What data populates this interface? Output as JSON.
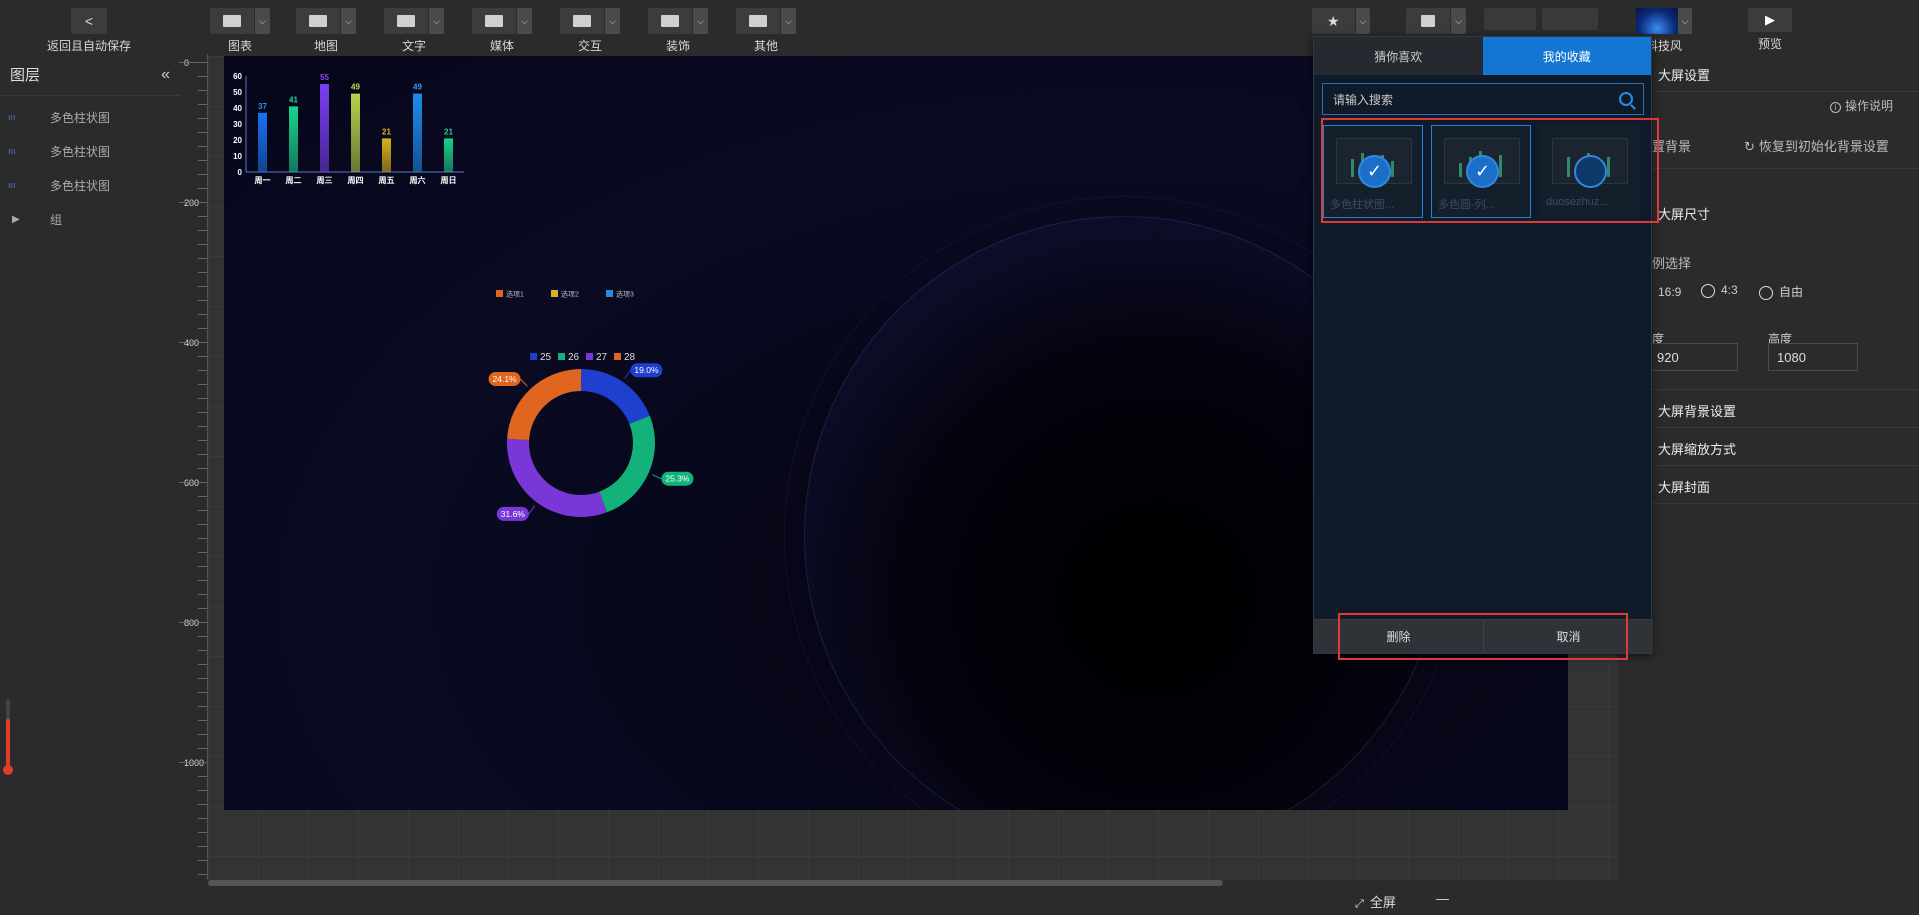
{
  "toolbar": {
    "back_label": "返回且自动保存",
    "items": [
      {
        "label": "图表",
        "icon": "chart-icon"
      },
      {
        "label": "地图",
        "icon": "map-icon"
      },
      {
        "label": "文字",
        "icon": "text-icon"
      },
      {
        "label": "媒体",
        "icon": "media-icon"
      },
      {
        "label": "交互",
        "icon": "interaction-icon"
      },
      {
        "label": "装饰",
        "icon": "decoration-icon"
      },
      {
        "label": "其他",
        "icon": "other-icon"
      }
    ],
    "theme_label": "科技风",
    "preview_label": "预览"
  },
  "layers": {
    "title": "图层",
    "items": [
      {
        "label": "多色柱状图",
        "icon_text": "ııı"
      },
      {
        "label": "多色柱状图",
        "icon_text": "ııı"
      },
      {
        "label": "多色柱状图",
        "icon_text": "ııı"
      }
    ],
    "group_label": "组"
  },
  "ruler": {
    "labels": [
      "0",
      "200",
      "400",
      "600",
      "800",
      "1000"
    ]
  },
  "chart_data": [
    {
      "type": "bar",
      "categories": [
        "周一",
        "周二",
        "周三",
        "周四",
        "周五",
        "周六",
        "周日"
      ],
      "values": [
        37,
        41,
        55,
        49,
        21,
        49,
        21
      ],
      "ylim": [
        0,
        60
      ],
      "yticks": [
        "0",
        "10",
        "20",
        "30",
        "40",
        "50",
        "60"
      ],
      "colors": [
        "#1a72f0",
        "#19d48e",
        "#7b3ff2",
        "#b8d24a",
        "#d8b41a",
        "#1f8cf0",
        "#1ed08a"
      ],
      "label_colors": [
        "#2f8ff0",
        "#21d49a",
        "#8a4cf2",
        "#c8dc4f",
        "#e3b824",
        "#2f9cf0",
        "#21d49a"
      ]
    },
    {
      "type": "bar",
      "categories": [],
      "values": [],
      "legend": [
        "选项1",
        "选项2",
        "选项3"
      ],
      "legend_colors": [
        "#e0661f",
        "#d9b51d",
        "#2f88e0"
      ]
    },
    {
      "type": "pie",
      "categories": [
        "25",
        "26",
        "27",
        "28"
      ],
      "values": [
        19.0,
        25.3,
        31.6,
        24.1
      ],
      "labels": [
        "19.0%",
        "25.3%",
        "31.6%",
        "24.1%"
      ],
      "colors": [
        "#1f3fcf",
        "#12b27a",
        "#7a37d8",
        "#e0661f"
      ]
    }
  ],
  "popup": {
    "tabs": [
      "猜你喜欢",
      "我的收藏"
    ],
    "active_tab": "我的收藏",
    "search_placeholder": "请输入搜索",
    "favorites": [
      {
        "name": "多色柱状图...",
        "checked": true
      },
      {
        "name": "多色圆-列...",
        "checked": true
      },
      {
        "name": "duosezhuz...",
        "checked": false
      }
    ],
    "delete_label": "删除",
    "cancel_label": "取消"
  },
  "settings": {
    "title": "大屏设置",
    "help_label": "操作说明",
    "bg_label": "置背景",
    "reset_bg_label": "恢复到初始化背景设置",
    "size_section": "大屏尺寸",
    "ratio_label": "例选择",
    "ratios": [
      "16:9",
      "4:3",
      "自由"
    ],
    "width_label": "度",
    "height_label": "高度",
    "width_value": "920",
    "height_value": "1080",
    "sections": [
      "大屏背景设置",
      "大屏缩放方式",
      "大屏封面"
    ]
  },
  "statusbar": {
    "fullscreen_label": "全屏",
    "zoom_minus": "—"
  },
  "colors": {
    "accent": "#1476d3",
    "highlight": "#e0393a",
    "canvas": "#07071a"
  }
}
